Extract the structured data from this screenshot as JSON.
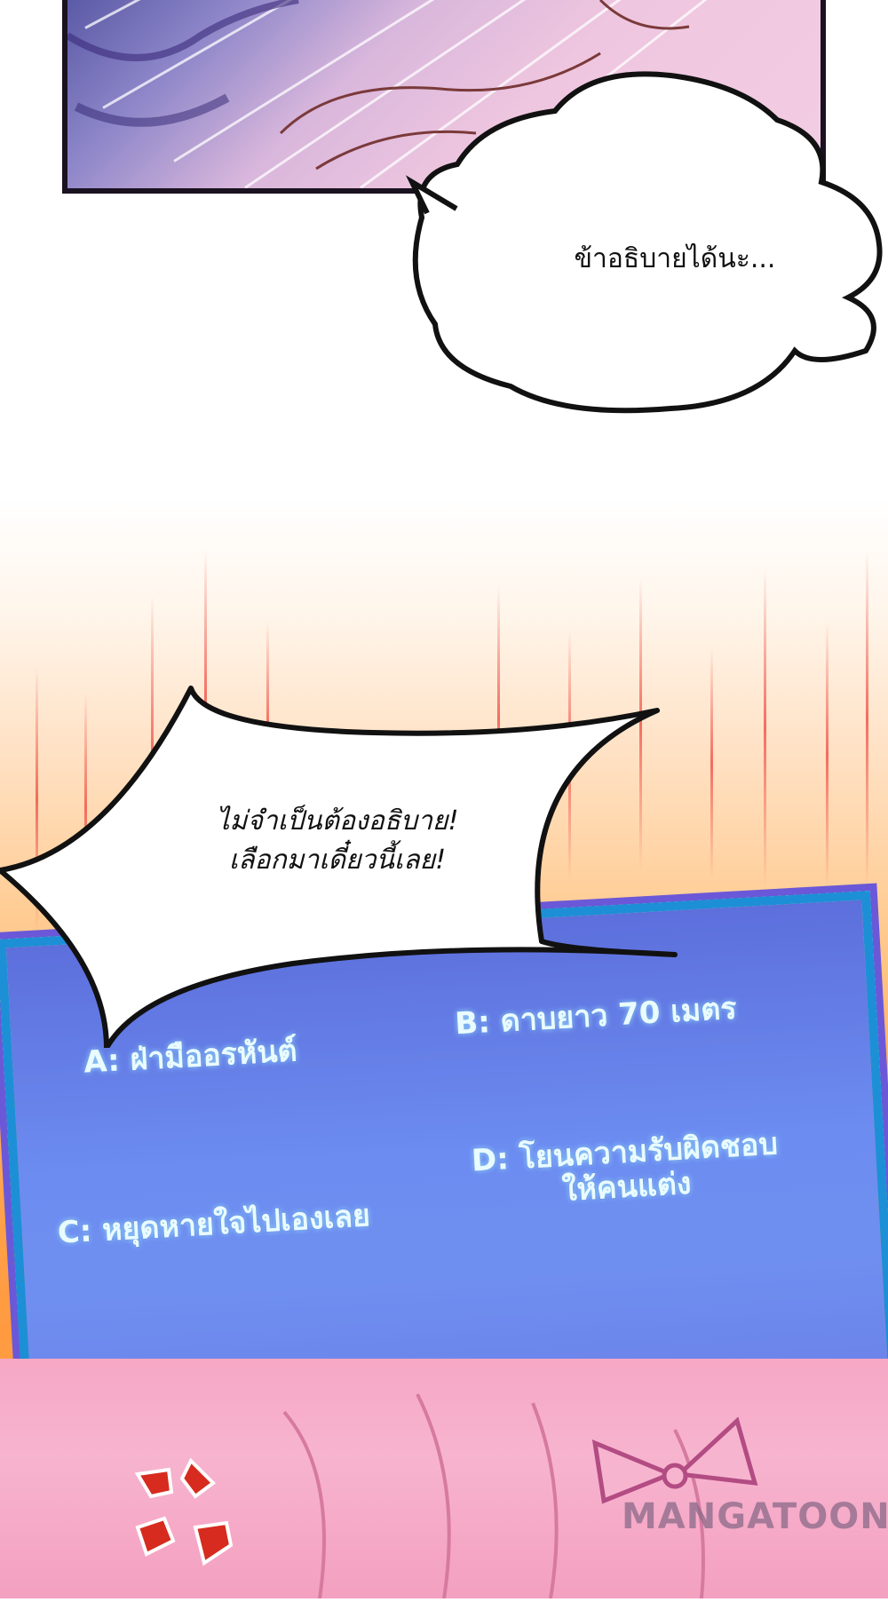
{
  "speech_bubble_1": {
    "text": "ข้าอธิบายได้นะ..."
  },
  "speech_bubble_2": {
    "line1": "ไม่จำเป็นต้องอธิบาย!",
    "line2": "เลือกมาเดี๋ยวนี้เลย!"
  },
  "quiz": {
    "option_a": "A: ฝ่ามืออรหันต์",
    "option_b": "B: ดาบยาว 70 เมตร",
    "option_c": "C: หยุดหายใจไปเองเลย",
    "option_d_line1": "D: โยนความรับผิดชอบ",
    "option_d_line2": "ให้คนแต่ง"
  },
  "watermark": {
    "text": "MANGATOON"
  },
  "colors": {
    "board_border": "#1d8fd6",
    "board_fill": "#6c8cf1",
    "option_text": "#e9fbff",
    "anger_mark": "#d62b1e"
  }
}
